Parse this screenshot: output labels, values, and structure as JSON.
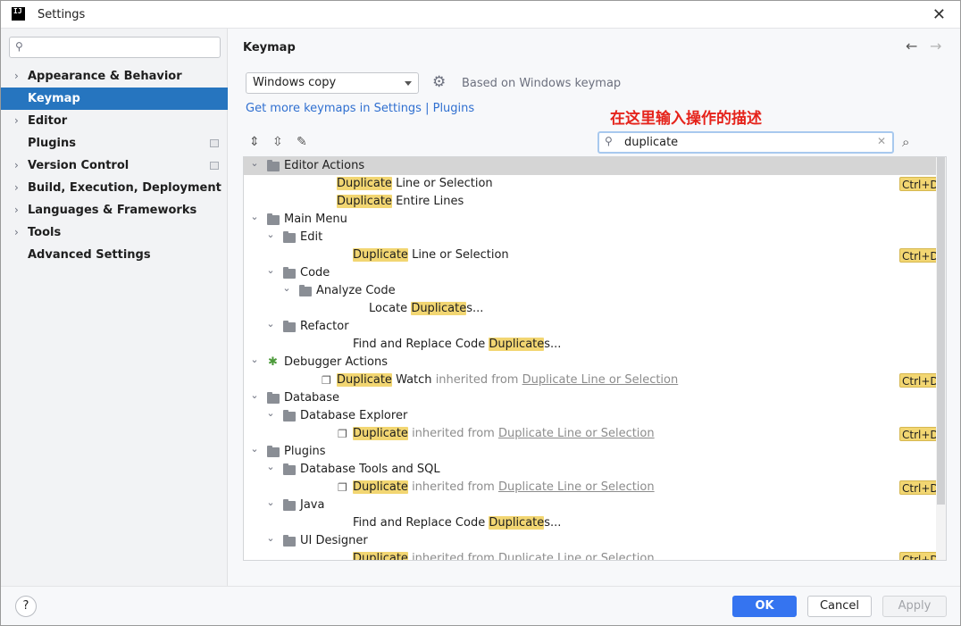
{
  "window": {
    "title": "Settings",
    "logo_text": "IJ"
  },
  "sidebar": {
    "search_placeholder": "",
    "items": [
      {
        "label": "Appearance & Behavior",
        "expandable": true
      },
      {
        "label": "Keymap",
        "selected": true
      },
      {
        "label": "Editor",
        "expandable": true
      },
      {
        "label": "Plugins",
        "badge": true
      },
      {
        "label": "Version Control",
        "expandable": true,
        "badge": true
      },
      {
        "label": "Build, Execution, Deployment",
        "expandable": true
      },
      {
        "label": "Languages & Frameworks",
        "expandable": true
      },
      {
        "label": "Tools",
        "expandable": true
      },
      {
        "label": "Advanced Settings"
      }
    ]
  },
  "main": {
    "title": "Keymap",
    "keymap_select": "Windows copy",
    "based_on": "Based on Windows keymap",
    "get_more": "Get more keymaps in Settings | Plugins",
    "annotation": "在这里输入操作的描述",
    "search_value": "duplicate"
  },
  "tree": [
    {
      "arrow": "⌄",
      "icon": "editor-folder",
      "parts": [
        {
          "t": "Editor Actions"
        }
      ],
      "selected": true
    },
    {
      "parts": [
        {
          "t": "Duplicate",
          "hl": true
        },
        {
          "t": " Line or Selection"
        }
      ],
      "shortcut": "Ctrl+D"
    },
    {
      "parts": [
        {
          "t": "Duplicate",
          "hl": true
        },
        {
          "t": " Entire Lines"
        }
      ]
    },
    {
      "arrow": "⌄",
      "icon": "menu-folder",
      "parts": [
        {
          "t": "Main Menu"
        }
      ]
    },
    {
      "arrow": "⌄",
      "icon": "folder",
      "parts": [
        {
          "t": "Edit"
        }
      ]
    },
    {
      "parts": [
        {
          "t": "Duplicate",
          "hl": true
        },
        {
          "t": " Line or Selection"
        }
      ],
      "shortcut": "Ctrl+D"
    },
    {
      "arrow": "⌄",
      "icon": "folder",
      "parts": [
        {
          "t": "Code"
        }
      ]
    },
    {
      "arrow": "⌄",
      "icon": "folder",
      "parts": [
        {
          "t": "Analyze Code"
        }
      ]
    },
    {
      "parts": [
        {
          "t": "Locate "
        },
        {
          "t": "Duplicate",
          "hl": true
        },
        {
          "t": "s..."
        }
      ]
    },
    {
      "arrow": "⌄",
      "icon": "folder",
      "parts": [
        {
          "t": "Refactor"
        }
      ]
    },
    {
      "parts": [
        {
          "t": "Find and Replace Code "
        },
        {
          "t": "Duplicate",
          "hl": true
        },
        {
          "t": "s..."
        }
      ]
    },
    {
      "arrow": "⌄",
      "icon": "bug",
      "parts": [
        {
          "t": "Debugger Actions"
        }
      ]
    },
    {
      "icon": "copy",
      "parts": [
        {
          "t": "Duplicate",
          "hl": true
        },
        {
          "t": " Watch "
        },
        {
          "t": "inherited from ",
          "inh": true
        },
        {
          "t": "Duplicate Line or Selection",
          "ul": true
        }
      ],
      "shortcut": "Ctrl+D"
    },
    {
      "arrow": "⌄",
      "icon": "folder",
      "parts": [
        {
          "t": "Database"
        }
      ]
    },
    {
      "arrow": "⌄",
      "icon": "folder",
      "parts": [
        {
          "t": "Database Explorer"
        }
      ]
    },
    {
      "icon": "copy",
      "parts": [
        {
          "t": "Duplicate",
          "hl": true
        },
        {
          "t": " inherited from ",
          "inh": true
        },
        {
          "t": "Duplicate Line or Selection",
          "ul": true
        }
      ],
      "shortcut": "Ctrl+D"
    },
    {
      "arrow": "⌄",
      "icon": "folder",
      "parts": [
        {
          "t": "Plugins"
        }
      ]
    },
    {
      "arrow": "⌄",
      "icon": "folder",
      "parts": [
        {
          "t": "Database Tools and SQL"
        }
      ]
    },
    {
      "icon": "copy",
      "parts": [
        {
          "t": "Duplicate",
          "hl": true
        },
        {
          "t": " inherited from ",
          "inh": true
        },
        {
          "t": "Duplicate Line or Selection",
          "ul": true
        }
      ],
      "shortcut": "Ctrl+D"
    },
    {
      "arrow": "⌄",
      "icon": "folder",
      "parts": [
        {
          "t": "Java"
        }
      ]
    },
    {
      "parts": [
        {
          "t": "Find and Replace Code "
        },
        {
          "t": "Duplicate",
          "hl": true
        },
        {
          "t": "s..."
        }
      ]
    },
    {
      "arrow": "⌄",
      "icon": "folder",
      "parts": [
        {
          "t": "UI Designer"
        }
      ]
    },
    {
      "parts": [
        {
          "t": "Duplicate",
          "hl": true
        },
        {
          "t": " inherited from ",
          "inh": true
        },
        {
          "t": "Duplicate Line or Selection",
          "ul": true
        }
      ],
      "shortcut": "Ctrl+D"
    }
  ],
  "buttons": {
    "help": "?",
    "ok": "OK",
    "cancel": "Cancel",
    "apply": "Apply"
  },
  "colors": {
    "accent": "#2675bf",
    "highlight": "#f2d672",
    "annotation": "#e5231b"
  }
}
